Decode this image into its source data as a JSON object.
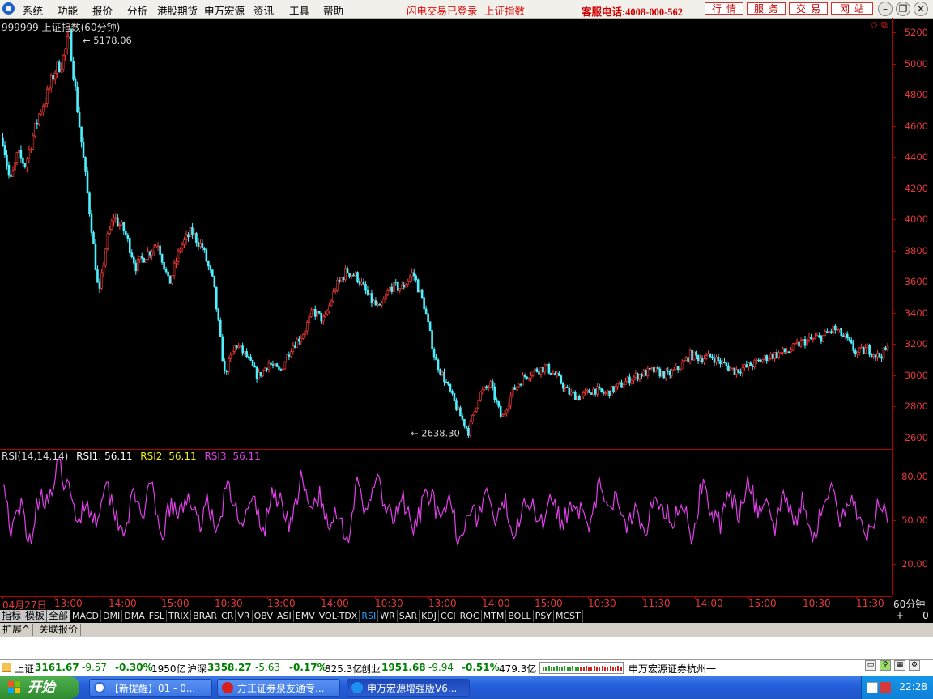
{
  "menu": {
    "items": [
      "系统",
      "功能",
      "报价",
      "分析",
      "港股期货",
      "申万宏源",
      "资讯",
      "工具",
      "帮助"
    ],
    "status_links": [
      "闪电交易已登录",
      "上证指数"
    ],
    "hotline": "客服电话:4008-000-562",
    "buttons": [
      "行情",
      "服务",
      "交易",
      "网站"
    ]
  },
  "chart": {
    "title": "999999 上证指数(60分钟)",
    "high_label": "5178.06",
    "low_label": "2638.30",
    "price_ticks": [
      "5200",
      "5000",
      "4800",
      "4600",
      "4400",
      "4200",
      "4000",
      "3800",
      "3600",
      "3400",
      "3200",
      "3000",
      "2800",
      "2600"
    ],
    "rsi_ticks": [
      "80.00",
      "50.00",
      "20.00"
    ],
    "rsi_legend": {
      "name": "RSI(14,14,14)",
      "rsi1": "RSI1: 56.11",
      "rsi2": "RSI2: 56.11",
      "rsi3": "RSI3: 56.11"
    },
    "time_labels": [
      "04月27日",
      "13:00",
      "14:00",
      "15:00",
      "10:30",
      "13:00",
      "14:00",
      "10:30",
      "13:00",
      "14:00",
      "15:00",
      "10:30",
      "11:30",
      "14:00",
      "15:00",
      "10:30",
      "11:30"
    ],
    "period": "60分钟"
  },
  "chart_data": {
    "type": "line",
    "title": "999999 上证指数(60分钟)",
    "xlabel": "",
    "ylabel": "",
    "ylim": [
      2580,
      5250
    ],
    "annotations": [
      {
        "label": "5178.06",
        "value": 5178.06
      },
      {
        "label": "2638.30",
        "value": 2638.3
      }
    ],
    "price_series": {
      "x": [
        0,
        2,
        4,
        6,
        8,
        10,
        12,
        14,
        16,
        18,
        20,
        22,
        24,
        26,
        28,
        30,
        33,
        36,
        39,
        42,
        45,
        48,
        51,
        54,
        57,
        60,
        63,
        66,
        69,
        72,
        75,
        78,
        81,
        84,
        87,
        90,
        93,
        96,
        99,
        102,
        105,
        108,
        111,
        114,
        117,
        120,
        123,
        126,
        129,
        132,
        135,
        138,
        141,
        144,
        147,
        150,
        153,
        156,
        160,
        163,
        166,
        170,
        173,
        176,
        180,
        183,
        186,
        189,
        192,
        195,
        198,
        201,
        204,
        207,
        210,
        213,
        216,
        219,
        222,
        225,
        228,
        231,
        234,
        237,
        240
      ],
      "values": [
        4520,
        4230,
        4420,
        4350,
        4520,
        4690,
        4800,
        4950,
        5010,
        5178,
        4750,
        4350,
        3950,
        3500,
        3850,
        4020,
        3920,
        3700,
        3780,
        3850,
        3580,
        3820,
        3920,
        3820,
        3590,
        3010,
        3200,
        3120,
        2990,
        3080,
        3020,
        3180,
        3260,
        3410,
        3350,
        3560,
        3670,
        3630,
        3500,
        3420,
        3570,
        3560,
        3660,
        3450,
        3100,
        2950,
        2780,
        2638,
        2880,
        2940,
        2720,
        2900,
        2990,
        3030,
        3050,
        2990,
        2890,
        2860,
        2910,
        2880,
        2920,
        2980,
        3010,
        3030,
        3000,
        3050,
        3130,
        3110,
        3120,
        3070,
        3030,
        3050,
        3080,
        3120,
        3140,
        3160,
        3210,
        3230,
        3250,
        3300,
        3240,
        3140,
        3170,
        3120,
        3180
      ]
    },
    "rsi_series": {
      "name": "RSI3",
      "x_count": 240,
      "values": [
        82,
        40,
        60,
        35,
        70,
        62,
        88,
        72,
        50,
        64,
        48,
        78,
        58,
        42,
        66,
        55,
        72,
        36,
        60,
        52,
        70,
        44,
        66,
        38,
        74,
        58,
        50,
        64,
        40,
        70,
        62,
        46,
        78,
        56,
        68,
        42,
        60,
        34,
        74,
        52,
        82,
        60,
        48,
        66,
        40,
        58,
        72,
        44,
        64,
        36,
        60,
        52,
        70,
        46,
        62,
        40,
        68,
        56,
        50,
        72,
        44,
        64,
        58,
        38,
        76,
        54,
        66,
        48,
        60,
        42,
        70,
        58,
        50,
        64,
        36,
        74,
        60,
        46,
        68,
        52,
        80,
        56,
        62,
        44,
        70,
        50,
        64,
        38,
        58,
        72,
        46,
        66,
        54,
        40,
        62,
        56
      ]
    },
    "y_rsi_ticks": [
      80,
      50,
      20
    ]
  },
  "tabs": {
    "gray": [
      "指标",
      "模板",
      "全部"
    ],
    "indicators": [
      "MACD",
      "DMI",
      "DMA",
      "FSL",
      "TRIX",
      "BRAR",
      "CR",
      "VR",
      "OBV",
      "ASI",
      "EMV",
      "VOL-TDX",
      "RSI",
      "WR",
      "SAR",
      "KDJ",
      "CCI",
      "ROC",
      "MTM",
      "BOLL",
      "PSY",
      "MCST"
    ],
    "active": "RSI",
    "right_controls": [
      "+",
      "-",
      "0"
    ]
  },
  "expand": [
    "扩展^",
    "关联报价"
  ],
  "status": {
    "sh_name": "上证",
    "sh_val": "3161.67",
    "sh_chg": "-9.57",
    "sh_pct": "-0.30%",
    "sh_amt": "1950亿",
    "hs_name": "沪深",
    "hs_val": "3358.27",
    "hs_chg": "-5.63",
    "hs_pct": "-0.17%",
    "hs_amt": "825.3亿",
    "cy_name": "创业",
    "cy_val": "1951.68",
    "cy_chg": "-9.94",
    "cy_pct": "-0.51%",
    "cy_amt": "479.3亿",
    "broker": "申万宏源证券杭州一"
  },
  "taskbar": {
    "start": "开始",
    "tasks": [
      "【新提醒】01 - 0...",
      "方正证券泉友通专...",
      "申万宏源增强版V6..."
    ],
    "clock": "22:28"
  },
  "colors": {
    "bg": "#000000",
    "axis_red": "#b00000",
    "up_red": "#ff3b3b",
    "down_cyan": "#4ff0ff",
    "rsi_magenta": "#e040e8",
    "yellow": "#f0f000"
  }
}
